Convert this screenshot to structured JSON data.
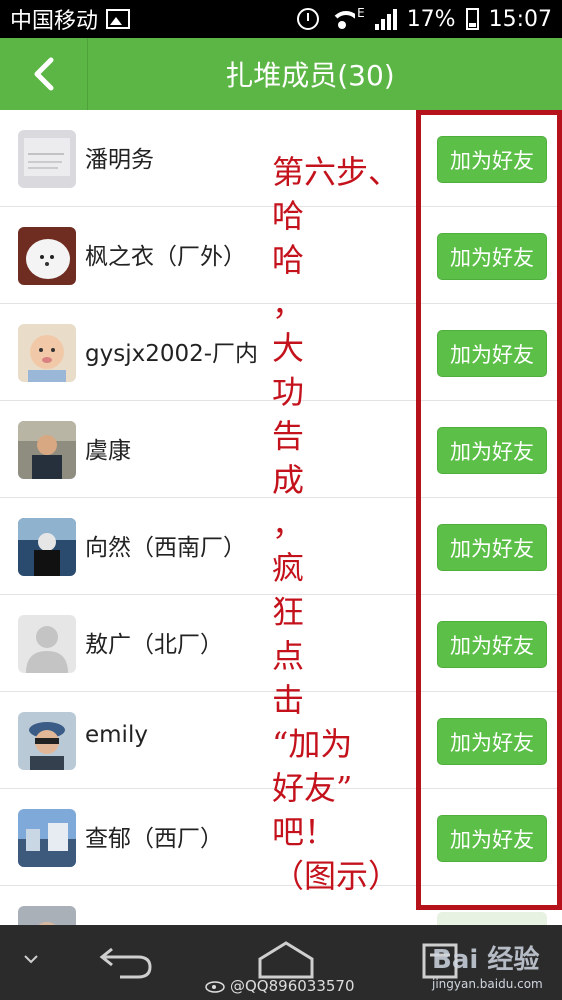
{
  "status_bar": {
    "carrier": "中国移动",
    "signal_type": "E",
    "battery": "17%",
    "time": "15:07"
  },
  "header": {
    "back_icon": "chevron-left-icon",
    "title": "扎堆成员(30)"
  },
  "members": [
    {
      "name": "潘明务",
      "button": "加为好友"
    },
    {
      "name": "枫之衣（厂外）",
      "button": "加为好友"
    },
    {
      "name": "gysjx2002-厂内",
      "button": "加为好友"
    },
    {
      "name": "虞康",
      "button": "加为好友"
    },
    {
      "name": "向然（西南厂）",
      "button": "加为好友"
    },
    {
      "name": "敖广（北厂）",
      "button": "加为好友"
    },
    {
      "name": "emily",
      "button": "加为好友"
    },
    {
      "name": "查郁（西厂）",
      "button": "加为好友"
    }
  ],
  "annotation": {
    "lines": [
      "第六步、",
      "哈",
      "哈",
      "，",
      "大",
      "功",
      "告",
      "成",
      "，",
      "疯",
      "狂",
      "点",
      "击",
      "“加为",
      "好友”",
      "吧！",
      "（图示）"
    ],
    "color": "#c4121c"
  },
  "nav_bar": {
    "watermark_handle": "@QQ896033570",
    "baidu_mark": "Bai 经验",
    "baidu_url": "jingyan.baidu.com"
  },
  "colors": {
    "accent_green": "#5cb646",
    "button_green": "#5cc048",
    "annotation_red": "#b5121b"
  }
}
